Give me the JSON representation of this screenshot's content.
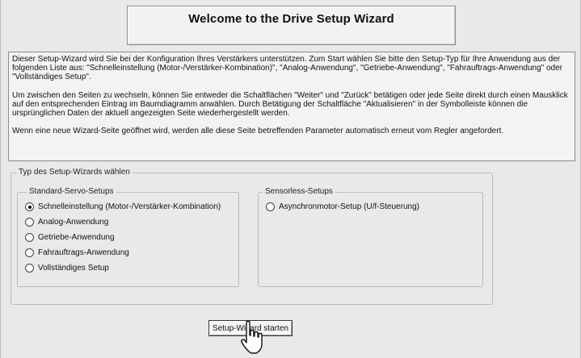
{
  "window": {
    "title": "Welcome to the Drive Setup Wizard"
  },
  "description": {
    "paragraphs": [
      "Dieser Setup-Wizard wird Sie bei der Konfiguration Ihres Verstärkers unterstützen. Zum Start wählen Sie bitte den Setup-Typ für Ihre Anwendung aus der folgenden Liste aus: \"Schnelleinstellung (Motor-/Verstärker-Kombination)\", \"Analog-Anwendung\", \"Getriebe-Anwendung\", \"Fahrauftrags-Anwendung\" oder \"Vollständiges Setup\".",
      "Um zwischen den Seiten zu wechseln, können Sie entweder die Schaltflächen \"Weiter\" und \"Zurück\" betätigen oder jede Seite direkt durch einen Mausklick auf den entsprechenden Eintrag im Baumdiagramm anwählen. Durch Betätigung der Schaltfläche \"Aktualisieren\" in der Symbolleiste können die ursprünglichen Daten der aktuell angezeigten Seite wiederhergestellt werden.",
      "Wenn eine neue Wizard-Seite geöffnet wird, werden alle diese Seite betreffenden Parameter automatisch erneut vom Regler angefordert."
    ]
  },
  "setup_type": {
    "label": "Typ des Setup-Wizards wählen",
    "standard": {
      "label": "Standard-Servo-Setups",
      "options": [
        {
          "label": "Schnelleinstellung (Motor-/Verstärker-Kombination)",
          "selected": true
        },
        {
          "label": "Analog-Anwendung",
          "selected": false
        },
        {
          "label": "Getriebe-Anwendung",
          "selected": false
        },
        {
          "label": "Fahrauftrags-Anwendung",
          "selected": false
        },
        {
          "label": "Vollständiges Setup",
          "selected": false
        }
      ]
    },
    "sensorless": {
      "label": "Sensorless-Setups",
      "options": [
        {
          "label": "Asynchronmotor-Setup (U/f-Steuerung)",
          "selected": false
        }
      ]
    }
  },
  "actions": {
    "start_label": "Setup-Wizard starten"
  },
  "cursor": {
    "icon": "hand-pointer-icon"
  }
}
